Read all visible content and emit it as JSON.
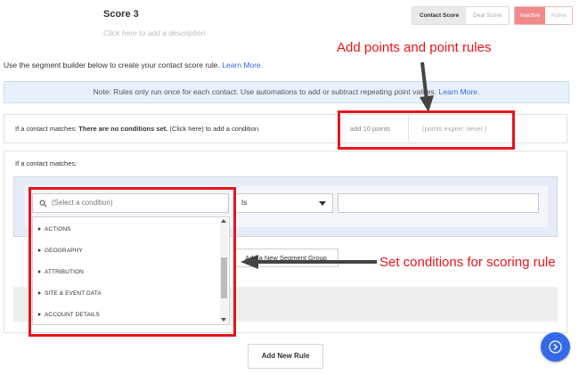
{
  "header": {
    "title": "Score 3",
    "description_placeholder": "Click here to add a description",
    "score_type": {
      "active": "Contact Score",
      "inactive": "Deal Score"
    },
    "status": {
      "selected": "Inactive",
      "other": "Active"
    }
  },
  "intro": {
    "text": "Use the segment builder below to create your contact score rule.",
    "link": "Learn More."
  },
  "note": {
    "text": "Note: Rules only run once for each contact. Use automations to add or subtract repeating point values.",
    "link": "Learn More."
  },
  "rule": {
    "prefix": "If a contact matches:",
    "conditions_bold": "There are no conditions set.",
    "conditions_suffix": "(Click here) to add a condition.",
    "points": "add 10 points",
    "expire": "(points expire:  never )"
  },
  "conditions": {
    "label": "If a contact matches:",
    "condition_placeholder": "(Select a condition)",
    "operator": "Is",
    "add_segment_group": "Add a New Segment Group",
    "dropdown_items": [
      "ACTIONS",
      "GEOGRAPHY",
      "ATTRIBUTION",
      "SITE & EVENT DATA",
      "ACCOUNT DETAILS"
    ]
  },
  "add_rule_button": "Add New Rule",
  "annotations": {
    "points_note": "Add points and point rules",
    "conditions_note": "Set conditions for scoring rule"
  },
  "colors": {
    "annotation_red": "#e8141b",
    "accent_blue": "#356ae6",
    "inactive_pink": "#f08a8a"
  },
  "icons": {
    "search": "search-icon",
    "dropdown_caret": "caret-down-icon",
    "fab": "chevron-right-icon"
  }
}
